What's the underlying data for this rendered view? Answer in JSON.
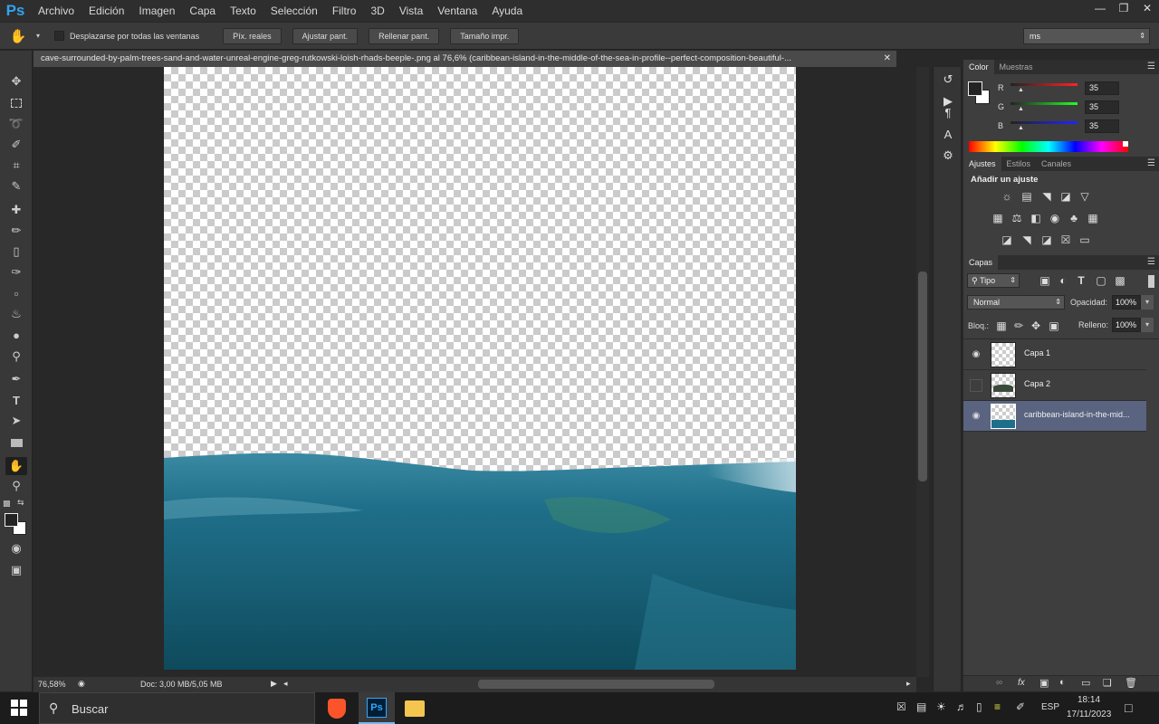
{
  "app": {
    "logo": "Ps",
    "accent": "#34a3f0"
  },
  "menu": [
    "Archivo",
    "Edición",
    "Imagen",
    "Capa",
    "Texto",
    "Selección",
    "Filtro",
    "3D",
    "Vista",
    "Ventana",
    "Ayuda"
  ],
  "options": {
    "scroll_all_label": "Desplazarse por todas las ventanas",
    "buttons": [
      "Píx. reales",
      "Ajustar pant.",
      "Rellenar pant.",
      "Tamaño impr."
    ],
    "workspace": "ms"
  },
  "document": {
    "tab_title": "cave-surrounded-by-palm-trees-sand-and-water-unreal-engine-greg-rutkowski-loish-rhads-beeple-.png al 76,6% (caribbean-island-in-the-middle-of-the-sea-in-profile--perfect-composition-beautiful-...",
    "zoom": "76,58%",
    "doc_info": "Doc: 3,00 MB/5,05 MB"
  },
  "color_panel": {
    "tabs": [
      "Color",
      "Muestras"
    ],
    "r": {
      "label": "R",
      "value": "35"
    },
    "g": {
      "label": "G",
      "value": "35"
    },
    "b": {
      "label": "B",
      "value": "35"
    }
  },
  "adjust_panel": {
    "tabs": [
      "Ajustes",
      "Estilos",
      "Canales"
    ],
    "title": "Añadir un ajuste"
  },
  "layers_panel": {
    "tab": "Capas",
    "filter": "Tipo",
    "blend_mode": "Normal",
    "opacity_label": "Opacidad:",
    "opacity": "100%",
    "lock_label": "Bloq.:",
    "fill_label": "Relleno:",
    "fill": "100%",
    "layers": [
      {
        "name": "Capa 1",
        "visible": true,
        "selected": false
      },
      {
        "name": "Capa 2",
        "visible": false,
        "selected": false
      },
      {
        "name": "caribbean-island-in-the-mid...",
        "visible": true,
        "selected": true
      }
    ]
  },
  "taskbar": {
    "search": "Buscar",
    "lang": "ESP",
    "time": "18:14",
    "date": "17/11/2023"
  }
}
